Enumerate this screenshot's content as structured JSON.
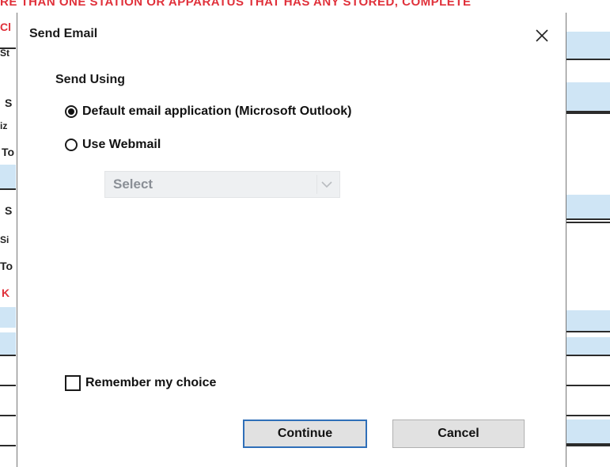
{
  "background": {
    "banner_text": "RE THAN ONE STATION OR APPARATUS THAT HAS ANY STORED, COMPLETE",
    "labels": [
      "Cl",
      "St",
      "S",
      "iz",
      "To",
      "S",
      "Si",
      "To",
      "K"
    ]
  },
  "dialog": {
    "title": "Send Email",
    "close_glyph": "✕",
    "send_using_label": "Send Using",
    "options": [
      {
        "label": "Default email application (Microsoft Outlook)",
        "selected": true
      },
      {
        "label": "Use Webmail",
        "selected": false
      }
    ],
    "webmail_select": {
      "value": "Select",
      "disabled": true
    },
    "remember_label": "Remember my choice",
    "remember_checked": false,
    "continue_label": "Continue",
    "cancel_label": "Cancel"
  },
  "colors": {
    "accent_border": "#2f6fb8",
    "banner_red": "#e0303a",
    "field_blue": "#cfe5f5"
  }
}
